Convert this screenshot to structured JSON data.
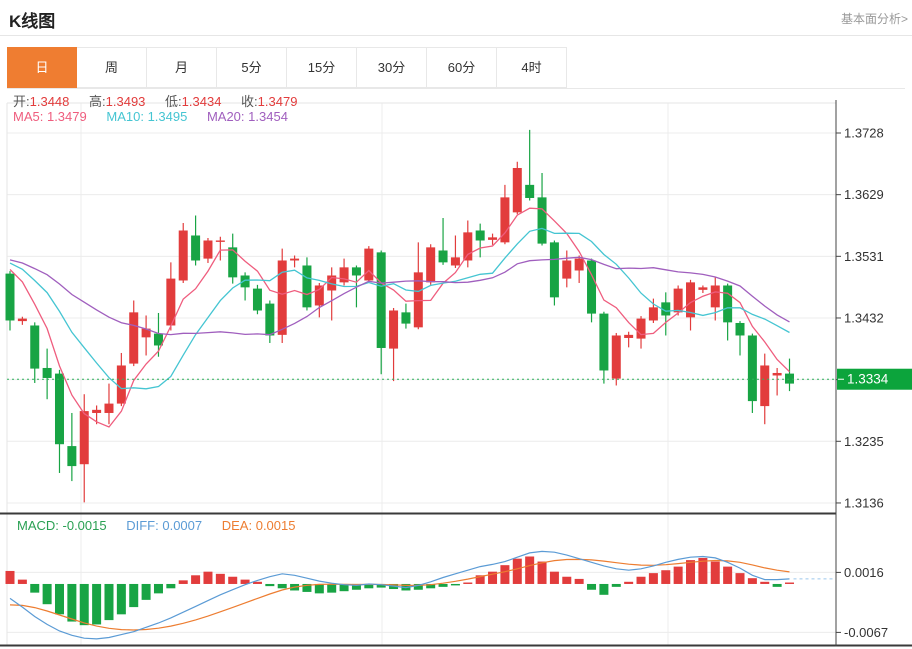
{
  "header": {
    "title": "K线图",
    "analysis_link": "基本面分析>"
  },
  "tabs": {
    "items": [
      "日",
      "周",
      "月",
      "5分",
      "15分",
      "30分",
      "60分",
      "4时"
    ],
    "active": "日"
  },
  "indicator_bar": {
    "open_label": "开:",
    "open": "1.3448",
    "high_label": "高:",
    "high": "1.3493",
    "low_label": "低:",
    "low": "1.3434",
    "close_label": "收:",
    "close": "1.3479",
    "ma5_label": "MA5:",
    "ma5": "1.3479",
    "ma10_label": "MA10:",
    "ma10": "1.3495",
    "ma20_label": "MA20:",
    "ma20": "1.3454",
    "macd_label": "MACD:",
    "macd": "-0.0015",
    "diff_label": "DIFF:",
    "diff": "0.0007",
    "dea_label": "DEA:",
    "dea": "0.0015"
  },
  "chart_data": {
    "type": "candlestick",
    "panels": [
      "price",
      "macd"
    ],
    "y_ticks": [
      "1.3728",
      "1.3629",
      "1.3531",
      "1.3432",
      "1.3334",
      "1.3235",
      "1.3136"
    ],
    "current_price": "1.3334",
    "macd_ticks": [
      "0.0016",
      "-0.0067"
    ],
    "grid": true,
    "legend": [
      "MA5",
      "MA10",
      "MA20",
      "MACD",
      "DIFF",
      "DEA"
    ],
    "candles_ohlc": [
      [
        1.3503,
        1.3507,
        1.3412,
        1.3428
      ],
      [
        1.3427,
        1.3434,
        1.3421,
        1.3431
      ],
      [
        1.342,
        1.3425,
        1.3328,
        1.3351
      ],
      [
        1.3352,
        1.3383,
        1.3302,
        1.3336
      ],
      [
        1.3343,
        1.3349,
        1.3184,
        1.323
      ],
      [
        1.3227,
        1.328,
        1.3171,
        1.3195
      ],
      [
        1.3198,
        1.331,
        1.3137,
        1.3283
      ],
      [
        1.328,
        1.3292,
        1.3262,
        1.3285
      ],
      [
        1.328,
        1.3327,
        1.3262,
        1.3295
      ],
      [
        1.3295,
        1.3376,
        1.3291,
        1.3356
      ],
      [
        1.3359,
        1.346,
        1.3355,
        1.3441
      ],
      [
        1.3401,
        1.3436,
        1.3372,
        1.3415
      ],
      [
        1.3407,
        1.344,
        1.337,
        1.3388
      ],
      [
        1.342,
        1.3521,
        1.3412,
        1.3495
      ],
      [
        1.3492,
        1.3584,
        1.3488,
        1.3572
      ],
      [
        1.3564,
        1.3596,
        1.3516,
        1.3524
      ],
      [
        1.3527,
        1.356,
        1.352,
        1.3556
      ],
      [
        1.3554,
        1.3562,
        1.3524,
        1.3556
      ],
      [
        1.3545,
        1.3567,
        1.3487,
        1.3497
      ],
      [
        1.35,
        1.3505,
        1.346,
        1.3481
      ],
      [
        1.3479,
        1.3485,
        1.3438,
        1.3444
      ],
      [
        1.3455,
        1.346,
        1.3392,
        1.3404
      ],
      [
        1.3405,
        1.3543,
        1.3392,
        1.3524
      ],
      [
        1.3524,
        1.3532,
        1.3513,
        1.3527
      ],
      [
        1.3516,
        1.3529,
        1.3444,
        1.3449
      ],
      [
        1.3452,
        1.3488,
        1.3433,
        1.3484
      ],
      [
        1.3476,
        1.3513,
        1.3428,
        1.35
      ],
      [
        1.3489,
        1.3527,
        1.3484,
        1.3513
      ],
      [
        1.3513,
        1.3516,
        1.3449,
        1.35
      ],
      [
        1.3492,
        1.3547,
        1.3489,
        1.3543
      ],
      [
        1.3537,
        1.354,
        1.3342,
        1.3384
      ],
      [
        1.3383,
        1.3448,
        1.3331,
        1.3444
      ],
      [
        1.3441,
        1.3455,
        1.3415,
        1.3423
      ],
      [
        1.3417,
        1.3553,
        1.3414,
        1.3505
      ],
      [
        1.3489,
        1.355,
        1.3485,
        1.3545
      ],
      [
        1.354,
        1.3592,
        1.3517,
        1.3521
      ],
      [
        1.3516,
        1.3564,
        1.3512,
        1.3529
      ],
      [
        1.3524,
        1.3588,
        1.3513,
        1.3569
      ],
      [
        1.3572,
        1.3583,
        1.3529,
        1.3556
      ],
      [
        1.3557,
        1.3567,
        1.3549,
        1.3561
      ],
      [
        1.3553,
        1.3645,
        1.355,
        1.3625
      ],
      [
        1.3601,
        1.3682,
        1.3598,
        1.3672
      ],
      [
        1.3645,
        1.3733,
        1.362,
        1.3624
      ],
      [
        1.3625,
        1.3664,
        1.3548,
        1.3551
      ],
      [
        1.3553,
        1.3556,
        1.3452,
        1.3465
      ],
      [
        1.3495,
        1.354,
        1.3481,
        1.3524
      ],
      [
        1.3508,
        1.3532,
        1.3488,
        1.3527
      ],
      [
        1.3524,
        1.3527,
        1.3425,
        1.3439
      ],
      [
        1.3439,
        1.3442,
        1.3327,
        1.3348
      ],
      [
        1.3335,
        1.3408,
        1.3324,
        1.3404
      ],
      [
        1.34,
        1.341,
        1.3385,
        1.3405
      ],
      [
        1.3399,
        1.3435,
        1.3383,
        1.3431
      ],
      [
        1.3428,
        1.3463,
        1.3424,
        1.3449
      ],
      [
        1.3457,
        1.3473,
        1.3404,
        1.3436
      ],
      [
        1.3441,
        1.3484,
        1.3436,
        1.3479
      ],
      [
        1.3433,
        1.3493,
        1.3412,
        1.3489
      ],
      [
        1.3477,
        1.3484,
        1.3472,
        1.3481
      ],
      [
        1.3449,
        1.3497,
        1.3428,
        1.3484
      ],
      [
        1.3484,
        1.3487,
        1.3396,
        1.3425
      ],
      [
        1.3424,
        1.3427,
        1.3372,
        1.3404
      ],
      [
        1.3404,
        1.3407,
        1.328,
        1.3299
      ],
      [
        1.3291,
        1.3375,
        1.3262,
        1.3356
      ],
      [
        1.334,
        1.3352,
        1.3308,
        1.3344
      ],
      [
        1.3343,
        1.3367,
        1.3315,
        1.3327
      ]
    ],
    "macd_hist": [
      0.0018,
      0.0006,
      -0.0012,
      -0.0028,
      -0.0042,
      -0.0052,
      -0.0057,
      -0.0056,
      -0.005,
      -0.0042,
      -0.0032,
      -0.0022,
      -0.0013,
      -0.0006,
      0.0005,
      0.0012,
      0.0017,
      0.0014,
      0.001,
      0.0006,
      0.0003,
      -0.0003,
      -0.0006,
      -0.0009,
      -0.0011,
      -0.0013,
      -0.0012,
      -0.001,
      -0.0008,
      -0.0006,
      -0.0005,
      -0.0007,
      -0.0009,
      -0.0008,
      -0.0006,
      -0.0004,
      -0.0002,
      0.0002,
      0.0012,
      0.0017,
      0.0026,
      0.0035,
      0.0038,
      0.0031,
      0.0017,
      0.001,
      0.0007,
      -0.0008,
      -0.0015,
      -0.0004,
      0.0003,
      0.001,
      0.0015,
      0.0019,
      0.0024,
      0.0033,
      0.0036,
      0.0031,
      0.0024,
      0.0015,
      0.0008,
      0.0003,
      -0.0004,
      0.0002
    ],
    "macd_diff": [
      -0.002,
      -0.0032,
      -0.0045,
      -0.0056,
      -0.0065,
      -0.0071,
      -0.0075,
      -0.0076,
      -0.0074,
      -0.007,
      -0.0066,
      -0.006,
      -0.0054,
      -0.0047,
      -0.0039,
      -0.0031,
      -0.0023,
      -0.0015,
      -0.0008,
      -0.0001,
      0.0005,
      0.001,
      0.0014,
      0.0012,
      0.0008,
      0.0004,
      0.0001,
      -0.0001,
      -0.0002,
      0.0,
      -0.0001,
      -0.0003,
      -0.0005,
      -0.0002,
      0.0003,
      0.0009,
      0.0014,
      0.0019,
      0.0024,
      0.0027,
      0.0031,
      0.0037,
      0.0043,
      0.0045,
      0.0044,
      0.004,
      0.0035,
      0.003,
      0.0025,
      0.0021,
      0.0019,
      0.0021,
      0.0025,
      0.003,
      0.0034,
      0.0037,
      0.0038,
      0.0036,
      0.003,
      0.0022,
      0.0012,
      0.0006,
      0.0006,
      0.0007
    ],
    "colors": {
      "up": "#e23c3c",
      "down": "#18a444",
      "ma5": "#ef5d7e",
      "ma10": "#45c5d2",
      "ma20": "#a05fbe",
      "diff_line": "#5b9bd5",
      "dea_line": "#ed7d31",
      "price_line": "#2fb25c",
      "price_badge": "#0ca43c",
      "tab_active": "#ef7d31"
    }
  }
}
